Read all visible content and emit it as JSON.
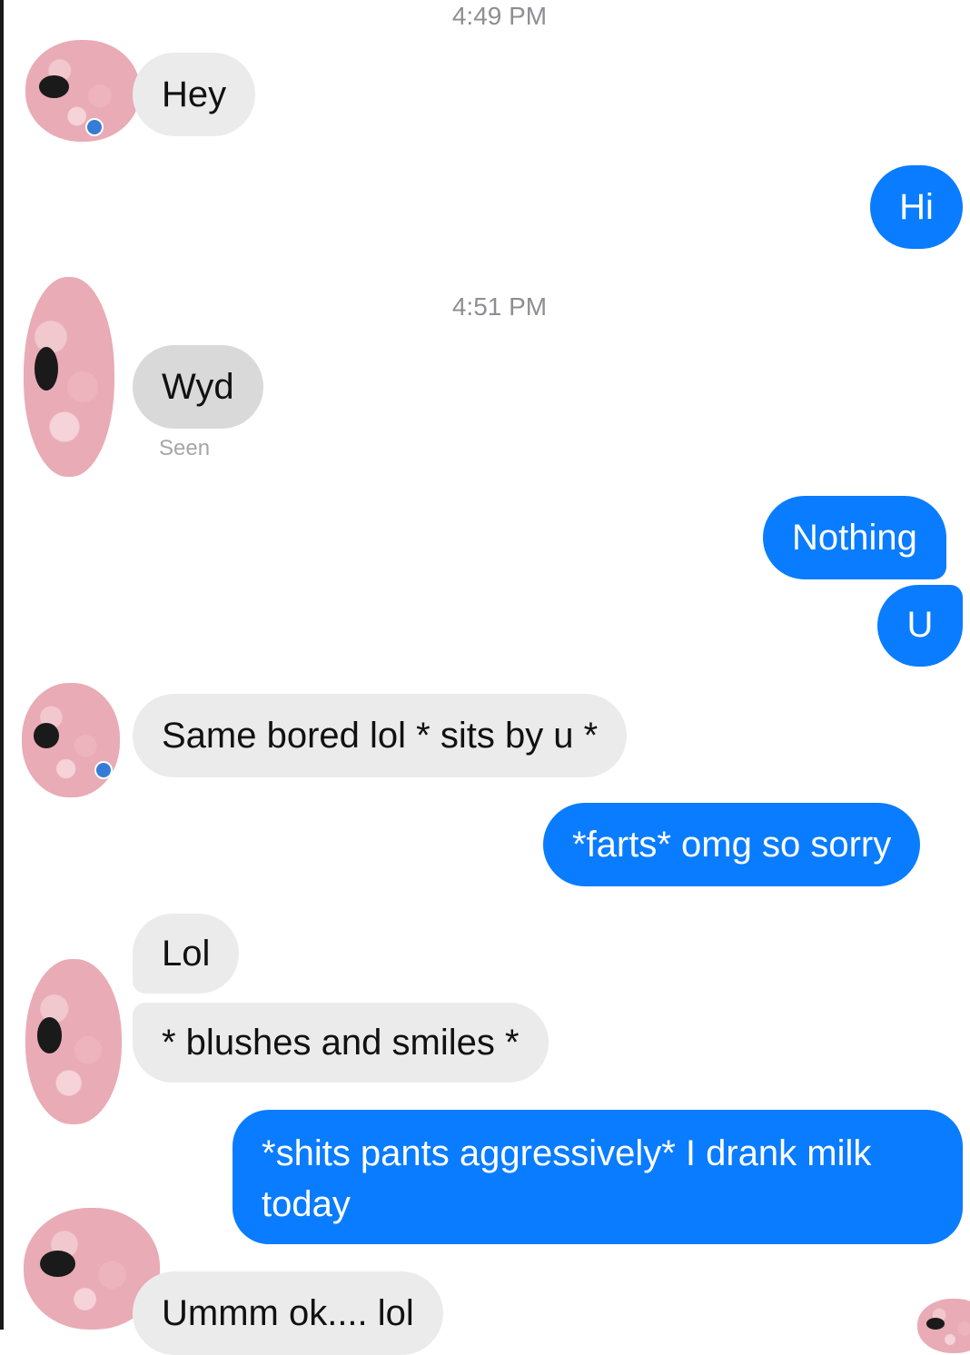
{
  "timestamps": [
    "4:49 PM",
    "4:51 PM"
  ],
  "messages": {
    "hey": "Hey",
    "hi": "Hi",
    "wyd": "Wyd",
    "seen": "Seen",
    "nothing": "Nothing",
    "u": "U",
    "same_bored": "Same bored lol * sits by u *",
    "farts": "*farts* omg so sorry",
    "lol": "Lol",
    "blushes": "* blushes and smiles *",
    "shits_line1": "*shits pants aggressively* I drank milk",
    "shits_line2": "today",
    "ummm": "Ummm ok.... lol"
  },
  "colors": {
    "incoming_bubble": "#ebebec",
    "outgoing_bubble": "#0a7cff",
    "timestamp_text": "#8e8e93"
  },
  "icons": {
    "avatar": "redacted-pink-avatar-icon",
    "status": "active-status-dot-icon"
  }
}
